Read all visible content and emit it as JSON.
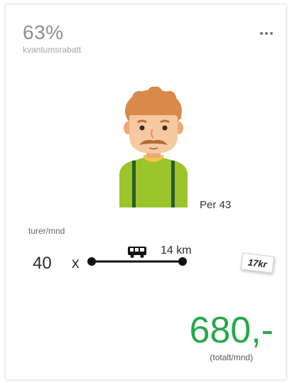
{
  "card": {
    "discount": {
      "value": "63%",
      "label": "kvantumsrabatt"
    },
    "menu_icon": "more-horizontal-icon",
    "person": {
      "name": "Per 43",
      "avatar_icon": "person-avatar-icon"
    },
    "trips": {
      "label": "turer/mnd",
      "count": "40",
      "times_symbol": "x"
    },
    "route": {
      "icon": "bus-icon",
      "distance": "14 km",
      "price_tag": "17kr"
    },
    "total": {
      "value": "680,-",
      "label": "(totalt/mnd)"
    }
  },
  "colors": {
    "accent_green": "#27a84a",
    "muted_text": "#8e8e8e"
  }
}
